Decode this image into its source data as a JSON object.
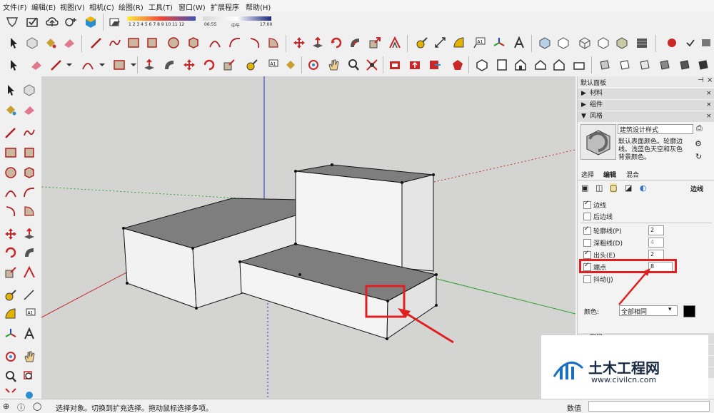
{
  "menu": [
    "文件(F)",
    "编辑(E)",
    "视图(V)",
    "相机(C)",
    "绘图(R)",
    "工具(T)",
    "窗口(W)",
    "扩展程序",
    "帮助(H)"
  ],
  "shadow_scale": {
    "hours": "1 2 3 4 5 6 7 8 9 10 11 12",
    "time_start": "06:55",
    "time_mid": "中午",
    "time_end": "17:00"
  },
  "tray": {
    "title": "默认面板",
    "sections": [
      "材料",
      "组件",
      "风格"
    ],
    "style_name": "建筑设计样式",
    "style_desc_1": "默认表面颜色。轮廓边",
    "style_desc_2": "线。浅蓝色天空和灰色",
    "style_desc_3": "背景颜色。",
    "tabs": [
      "选择",
      "编辑",
      "混合"
    ],
    "edge_heading": "边线",
    "edge_settings": [
      {
        "label": "边线",
        "checked": true,
        "value": ""
      },
      {
        "label": "后边线",
        "checked": false,
        "value": ""
      },
      {
        "label": "轮廓线(P)",
        "checked": true,
        "value": "2"
      },
      {
        "label": "深粗线(D)",
        "checked": false,
        "value": "4"
      },
      {
        "label": "出头(E)",
        "checked": true,
        "value": "2"
      },
      {
        "label": "端点",
        "checked": true,
        "value": "8"
      },
      {
        "label": "抖动(J)",
        "checked": false,
        "value": ""
      }
    ],
    "color_label": "颜色:",
    "color_value": "全部相同",
    "bottom_section": "图层"
  },
  "watermark": {
    "brand": "土木工程网",
    "url": "www.civilcn.com"
  },
  "status": {
    "message": "选择对象。切换到扩充选择。拖动鼠标选择多项。",
    "measure_label": "数值"
  }
}
